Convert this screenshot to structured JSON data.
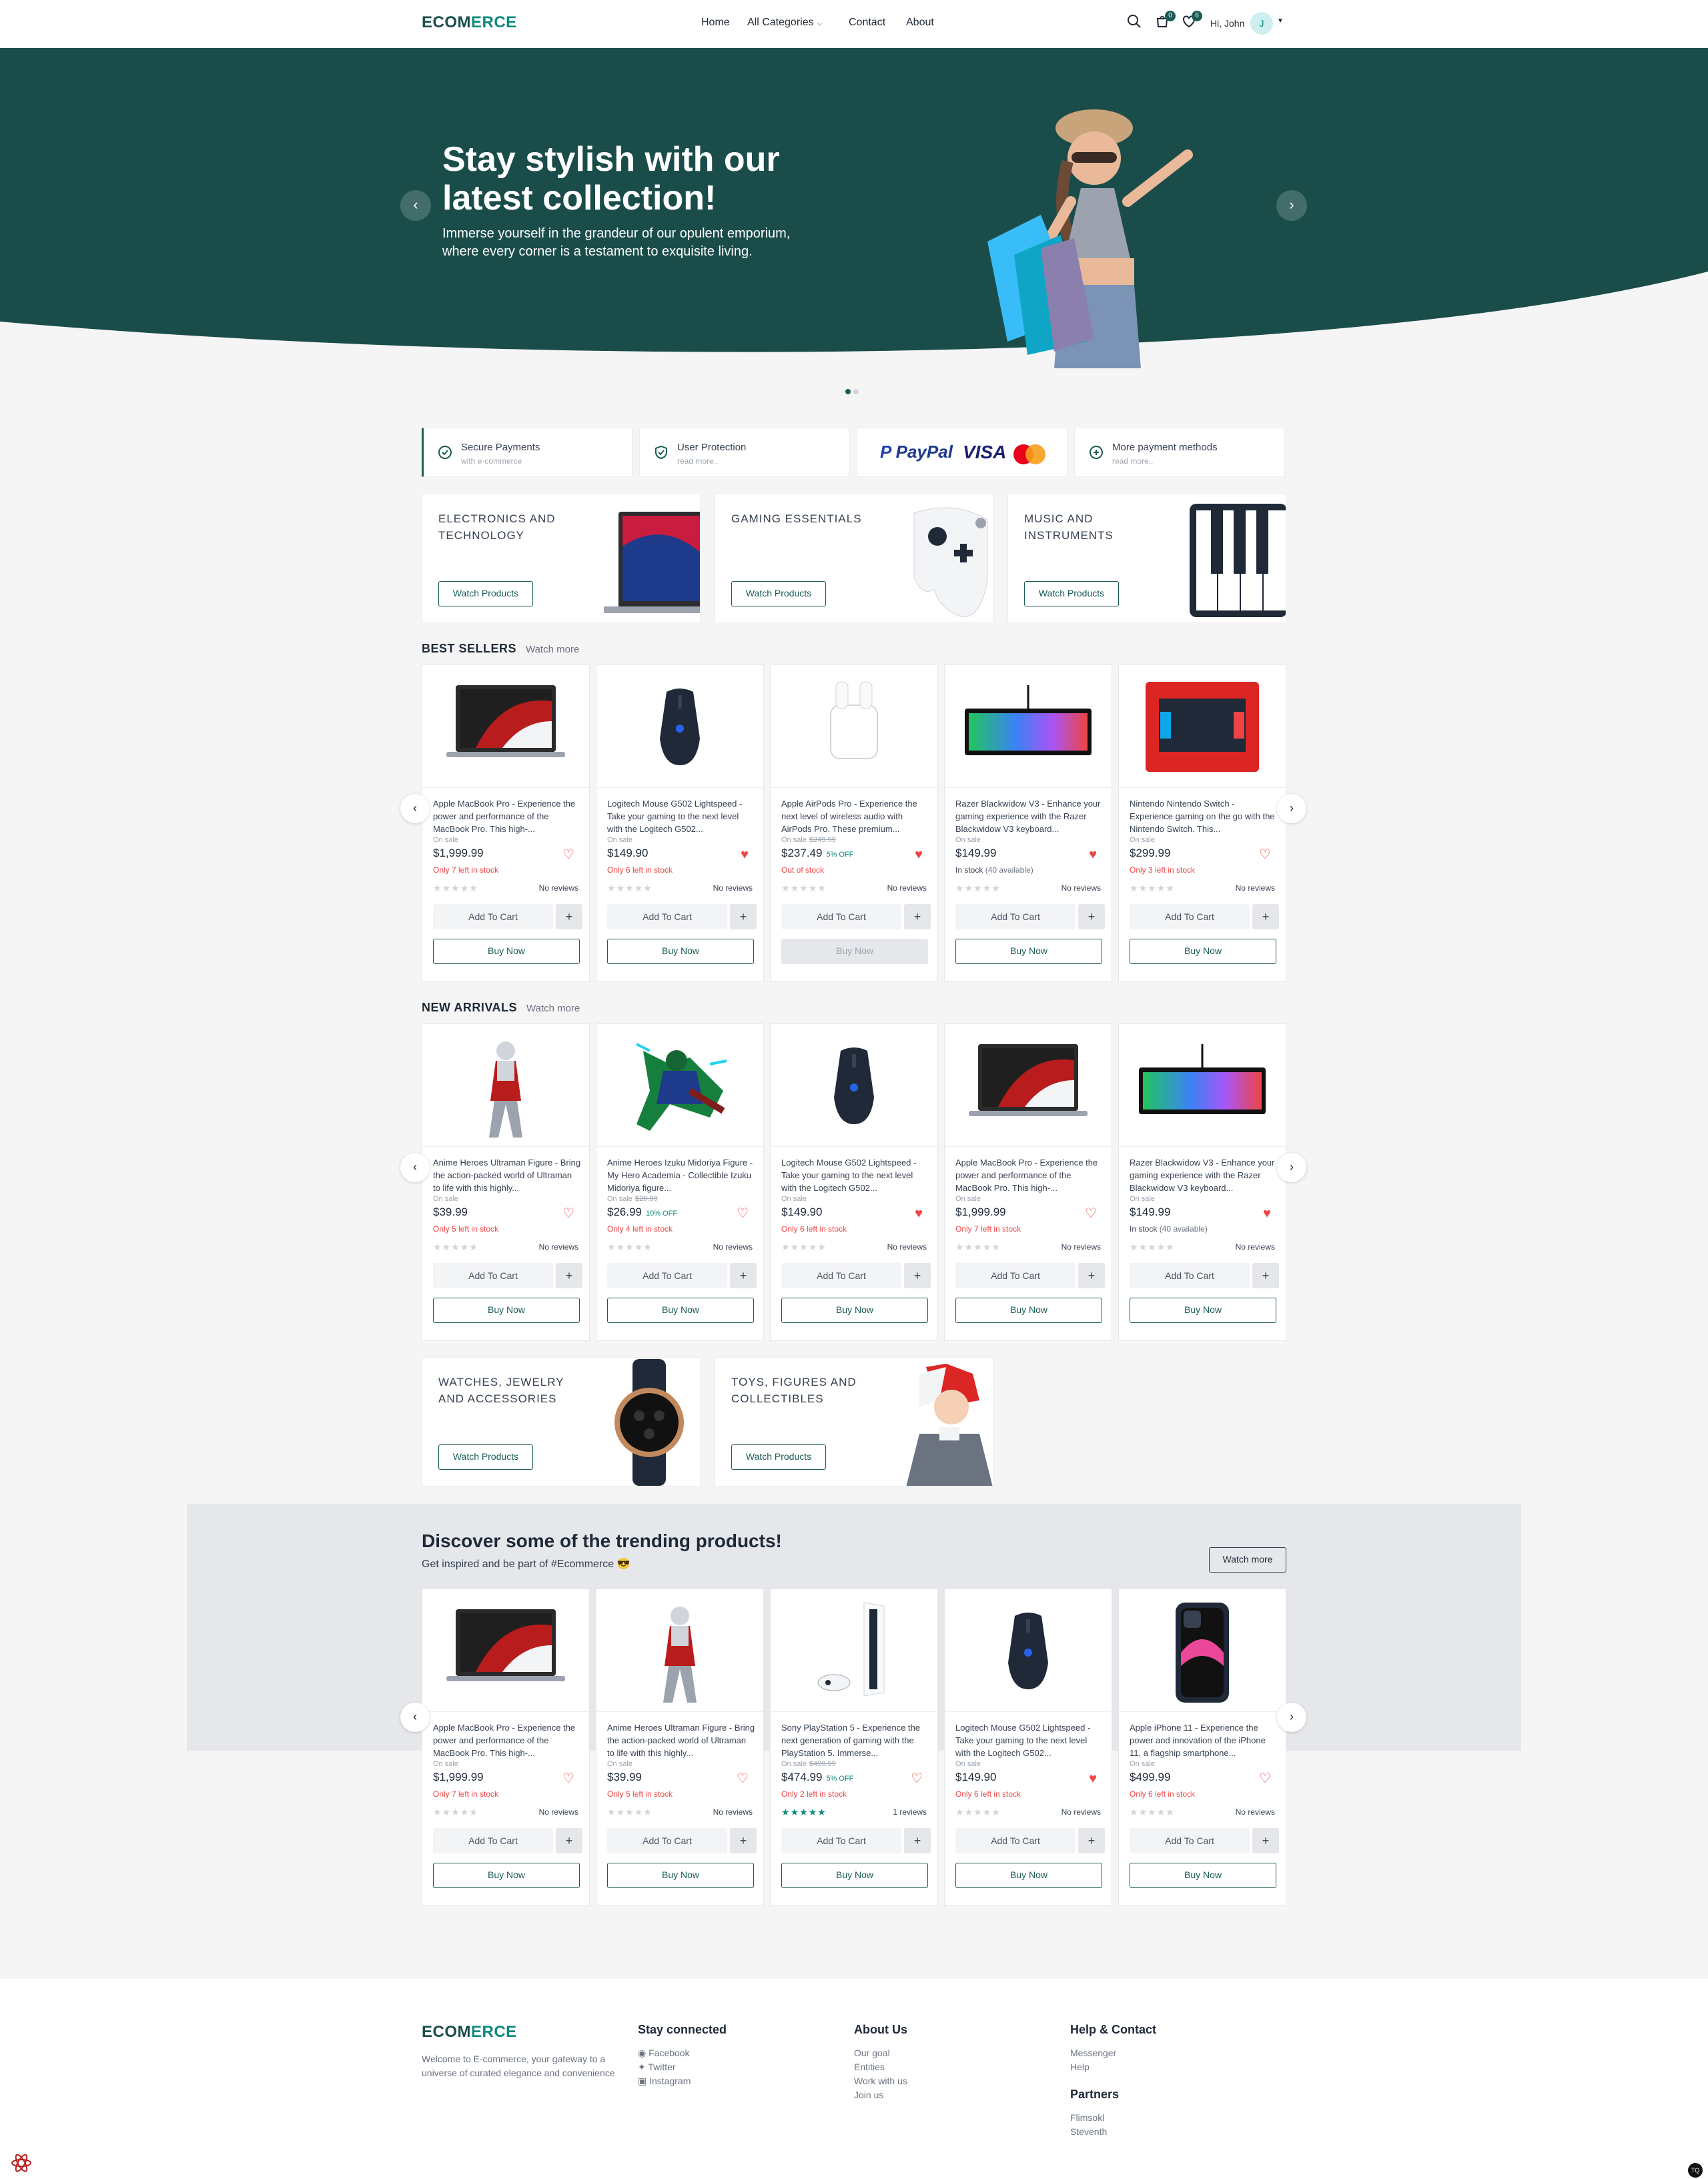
{
  "header": {
    "logo_a": "ECOM",
    "logo_b": "ERCE",
    "nav": [
      "Home",
      "All Categories",
      "Contact",
      "About"
    ],
    "cart_count": "0",
    "wishlist_count": "6",
    "greeting": "Hi, John",
    "avatar_initial": "J"
  },
  "hero": {
    "title": "Stay stylish with our latest collection!",
    "text": "Immerse yourself in the grandeur of our opulent emporium, where every corner is a testament to exquisite living.",
    "bg_color": "#1a4d4a"
  },
  "features": [
    {
      "title": "Secure Payments",
      "sub": "with e-commerce"
    },
    {
      "title": "User Protection",
      "sub": "read more.."
    },
    {
      "paypal": "PayPal",
      "visa": "VISA"
    },
    {
      "title": "More payment methods",
      "sub": "read more.."
    }
  ],
  "categories": [
    {
      "title": "ELECTRONICS AND TECHNOLOGY",
      "btn": "Watch Products"
    },
    {
      "title": "GAMING ESSENTIALS",
      "btn": "Watch Products"
    },
    {
      "title": "MUSIC AND INSTRUMENTS",
      "btn": "Watch Products"
    },
    {
      "title": "WATCHES, JEWELRY AND ACCESSORIES",
      "btn": "Watch Products"
    },
    {
      "title": "TOYS, FIGURES AND COLLECTIBLES",
      "btn": "Watch Products"
    }
  ],
  "best_sellers": {
    "title": "BEST SELLERS",
    "more": "Watch more",
    "products": [
      {
        "name": "Apple MacBook Pro - Experience the power and performance of the MacBook Pro. This high-...",
        "sale": "On sale",
        "was": "",
        "price": "$1,999.99",
        "off": "",
        "stock": "Only 7 left in stock",
        "stock_color": "#ef4444",
        "fav": false,
        "reviews": "No reviews",
        "stars": 0,
        "buy_disabled": false,
        "img": "macbook"
      },
      {
        "name": "Logitech Mouse G502 Lightspeed - Take your gaming to the next level with the Logitech G502...",
        "sale": "On sale",
        "was": "",
        "price": "$149.90",
        "off": "",
        "stock": "Only 6 left in stock",
        "stock_color": "#ef4444",
        "fav": true,
        "reviews": "No reviews",
        "stars": 0,
        "buy_disabled": false,
        "img": "mouse"
      },
      {
        "name": "Apple AirPods Pro - Experience the next level of wireless audio with AirPods Pro. These premium...",
        "sale": "On sale",
        "was": "$249.99",
        "price": "$237.49",
        "off": "5% OFF",
        "stock": "Out of stock",
        "stock_color": "#ef4444",
        "fav": true,
        "reviews": "No reviews",
        "stars": 0,
        "buy_disabled": true,
        "img": "airpods"
      },
      {
        "name": "Razer Blackwidow V3 - Enhance your gaming experience with the Razer Blackwidow V3 keyboard...",
        "sale": "On sale",
        "was": "",
        "price": "$149.99",
        "off": "",
        "stock": "In stock",
        "stock_extra": "(40 available)",
        "stock_color": "#374151",
        "fav": true,
        "reviews": "No reviews",
        "stars": 0,
        "buy_disabled": false,
        "img": "keyboard"
      },
      {
        "name": "Nintendo Nintendo Switch - Experience gaming on the go with the Nintendo Switch. This...",
        "sale": "On sale",
        "was": "",
        "price": "$299.99",
        "off": "",
        "stock": "Only 3 left in stock",
        "stock_color": "#ef4444",
        "fav": false,
        "reviews": "No reviews",
        "stars": 0,
        "buy_disabled": false,
        "img": "switch"
      }
    ]
  },
  "new_arrivals": {
    "title": "NEW ARRIVALS",
    "more": "Watch more",
    "products": [
      {
        "name": "Anime Heroes Ultraman Figure - Bring the action-packed world of Ultraman to life with this highly...",
        "sale": "On sale",
        "was": "",
        "price": "$39.99",
        "off": "",
        "stock": "Only 5 left in stock",
        "stock_color": "#ef4444",
        "fav": false,
        "reviews": "No reviews",
        "stars": 0,
        "buy_disabled": false,
        "img": "ultraman"
      },
      {
        "name": "Anime Heroes Izuku Midoriya Figure - My Hero Academia - Collectible Izuku Midoriya figure...",
        "sale": "On sale",
        "was": "$29.99",
        "price": "$26.99",
        "off": "10% OFF",
        "stock": "Only 4 left in stock",
        "stock_color": "#ef4444",
        "fav": false,
        "reviews": "No reviews",
        "stars": 0,
        "buy_disabled": false,
        "img": "izuku"
      },
      {
        "name": "Logitech Mouse G502 Lightspeed - Take your gaming to the next level with the Logitech G502...",
        "sale": "On sale",
        "was": "",
        "price": "$149.90",
        "off": "",
        "stock": "Only 6 left in stock",
        "stock_color": "#ef4444",
        "fav": true,
        "reviews": "No reviews",
        "stars": 0,
        "buy_disabled": false,
        "img": "mouse"
      },
      {
        "name": "Apple MacBook Pro - Experience the power and performance of the MacBook Pro. This high-...",
        "sale": "On sale",
        "was": "",
        "price": "$1,999.99",
        "off": "",
        "stock": "Only 7 left in stock",
        "stock_color": "#ef4444",
        "fav": false,
        "reviews": "No reviews",
        "stars": 0,
        "buy_disabled": false,
        "img": "macbook"
      },
      {
        "name": "Razer Blackwidow V3 - Enhance your gaming experience with the Razer Blackwidow V3 keyboard...",
        "sale": "On sale",
        "was": "",
        "price": "$149.99",
        "off": "",
        "stock": "In stock",
        "stock_extra": "(40 available)",
        "stock_color": "#374151",
        "fav": true,
        "reviews": "No reviews",
        "stars": 0,
        "buy_disabled": false,
        "img": "keyboard"
      }
    ]
  },
  "trending": {
    "title": "Discover some of the trending products!",
    "sub": "Get inspired and be part of #Ecommerce 😎",
    "more": "Watch more",
    "products": [
      {
        "name": "Apple MacBook Pro - Experience the power and performance of the MacBook Pro. This high-...",
        "sale": "On sale",
        "was": "",
        "price": "$1,999.99",
        "off": "",
        "stock": "Only 7 left in stock",
        "stock_color": "#ef4444",
        "fav": false,
        "reviews": "No reviews",
        "stars": 0,
        "buy_disabled": false,
        "img": "macbook"
      },
      {
        "name": "Anime Heroes Ultraman Figure - Bring the action-packed world of Ultraman to life with this highly...",
        "sale": "On sale",
        "was": "",
        "price": "$39.99",
        "off": "",
        "stock": "Only 5 left in stock",
        "stock_color": "#ef4444",
        "fav": false,
        "reviews": "No reviews",
        "stars": 0,
        "buy_disabled": false,
        "img": "ultraman"
      },
      {
        "name": "Sony PlayStation 5 - Experience the next generation of gaming with the PlayStation 5. Immerse...",
        "sale": "On sale",
        "was": "$499.99",
        "price": "$474.99",
        "off": "5% OFF",
        "stock": "Only 2 left in stock",
        "stock_color": "#ef4444",
        "fav": false,
        "reviews": "1 reviews",
        "stars": 5,
        "buy_disabled": false,
        "img": "ps5"
      },
      {
        "name": "Logitech Mouse G502 Lightspeed - Take your gaming to the next level with the Logitech G502...",
        "sale": "On sale",
        "was": "",
        "price": "$149.90",
        "off": "",
        "stock": "Only 6 left in stock",
        "stock_color": "#ef4444",
        "fav": true,
        "reviews": "No reviews",
        "stars": 0,
        "buy_disabled": false,
        "img": "mouse"
      },
      {
        "name": "Apple iPhone 11 - Experience the power and innovation of the iPhone 11, a flagship smartphone...",
        "sale": "On sale",
        "was": "",
        "price": "$499.99",
        "off": "",
        "stock": "Only 6 left in stock",
        "stock_color": "#ef4444",
        "fav": false,
        "reviews": "No reviews",
        "stars": 0,
        "buy_disabled": false,
        "img": "iphone"
      }
    ]
  },
  "card_labels": {
    "add_to_cart": "Add To Cart",
    "buy_now": "Buy Now",
    "plus": "+"
  },
  "footer": {
    "desc": "Welcome to E-commerce, your gateway to a universe of curated elegance and convenience",
    "stay_title": "Stay connected",
    "stay": [
      "Facebook",
      "Twitter",
      "Instagram"
    ],
    "about_title": "About Us",
    "about": [
      "Our goal",
      "Entities",
      "Work with us",
      "Join us"
    ],
    "help_title": "Help & Contact",
    "help": [
      "Messenger",
      "Help"
    ],
    "partners_title": "Partners",
    "partners": [
      "Flimsokl",
      "Steventh"
    ]
  },
  "colors": {
    "brand": "#1a5c55",
    "accent": "#0f8a7e",
    "sale_red": "#ef4444",
    "heart_red": "#ef4444"
  }
}
